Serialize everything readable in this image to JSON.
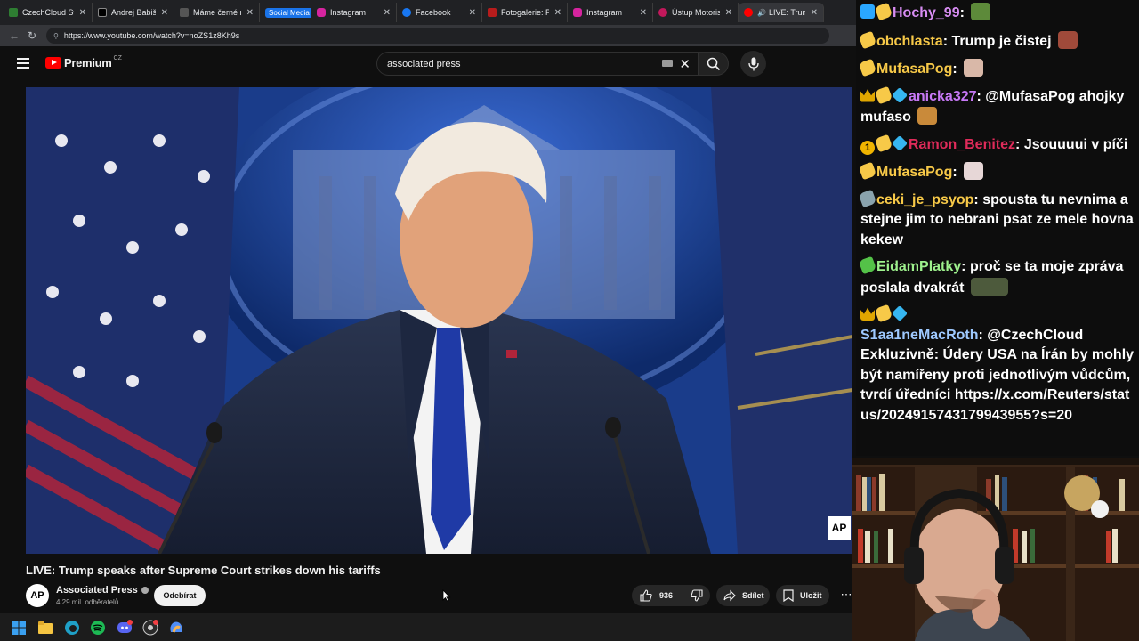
{
  "browser": {
    "tabs": [
      {
        "title": "CzechCloud Stre",
        "fav": "#2e7d32"
      },
      {
        "title": "Andrej Babiš na",
        "fav": "#000000"
      },
      {
        "title": "Máme černé na",
        "fav": "#555555"
      },
      {
        "title": "Instagram",
        "fav": "#d6249f"
      },
      {
        "title": "Facebook",
        "fav": "#1877f2"
      },
      {
        "title": "Fotogalerie: Pre",
        "fav": "#b71c1c"
      },
      {
        "title": "Instagram",
        "fav": "#d6249f"
      },
      {
        "title": "Ústup Motoristů",
        "fav": "#c2185b"
      },
      {
        "title": "LIVE: Trump",
        "fav": "#ff0000"
      }
    ],
    "tab_group_label": "Social Media",
    "url": "https://www.youtube.com/watch?v=noZS1z8Kh9s"
  },
  "youtube": {
    "brand": "Premium",
    "country": "CZ",
    "search_query": "associated press",
    "video_title": "LIVE: Trump speaks after Supreme Court strikes down his tariffs",
    "channel_name": "Associated Press",
    "channel_avatar_text": "AP",
    "subscribers": "4,29 mil. odběratelů",
    "subscribe_label": "Odebírat",
    "like_count": "936",
    "share_label": "Sdílet",
    "save_label": "Uložit",
    "ap_watermark": "AP"
  },
  "chat": {
    "messages": [
      {
        "user": "Hochy_99",
        "color": "#d78cf2",
        "text": ""
      },
      {
        "user": "obchlasta",
        "color": "#f7c948",
        "text": "Trump je čistej"
      },
      {
        "user": "MufasaPog",
        "color": "#f7c948",
        "text": ""
      },
      {
        "user": "anicka327",
        "color": "#c678f5",
        "text": "@MufasaPog ahojky mufaso"
      },
      {
        "user": "Ramon_Benitez",
        "color": "#e02b5a",
        "text": "Jsouuuui v píči"
      },
      {
        "user": "MufasaPog",
        "color": "#f7c948",
        "text": ""
      },
      {
        "user": "ceki_je_psyop",
        "color": "#f7c948",
        "text": "spousta tu nevnima a stejne jim to nebrani psat ze mele hovna kekew"
      },
      {
        "user": "EidamPlatky",
        "color": "#9ef28d",
        "text": "proč se ta moje zpráva poslala dvakrát"
      },
      {
        "user": "S1aa1neMacRoth",
        "color": "#9ec9ff",
        "text": "@CzechCloud Exkluzivně: Údery USA na Írán by mohly být namířeny proti jednotlivým vůdcům, tvrdí úředníci"
      },
      {
        "user": "",
        "color": "#ffffff",
        "text": "https://x.com/Reuters/status/2024915743179943955?s=20"
      }
    ],
    "badge_number": "1"
  },
  "colors": {
    "youtube_red": "#ff0000",
    "background": "#0f0f0f",
    "tab_group": "#1a73e8"
  }
}
